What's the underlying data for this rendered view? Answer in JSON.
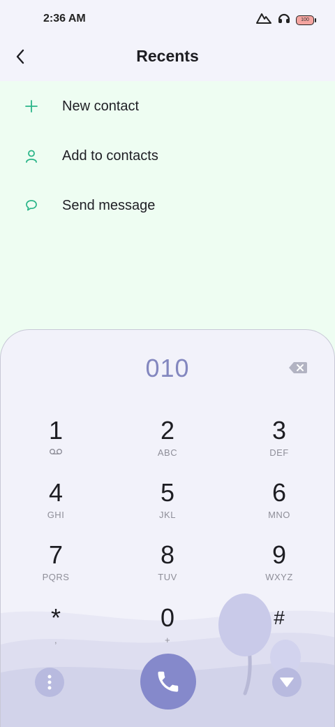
{
  "status_bar": {
    "time": "2:36 AM",
    "icons": [
      "signal-icon",
      "headset-icon",
      "battery-icon"
    ],
    "battery_level": "100"
  },
  "header": {
    "title": "Recents",
    "back_icon": "chevron-left-icon"
  },
  "actions": [
    {
      "label": "New contact",
      "icon": "plus-icon"
    },
    {
      "label": "Add to contacts",
      "icon": "person-icon"
    },
    {
      "label": "Send message",
      "icon": "message-bubble-icon"
    }
  ],
  "dialer": {
    "number": "010",
    "keys": [
      {
        "digit": "1",
        "sub": "voicemail-icon"
      },
      {
        "digit": "2",
        "sub": "ABC"
      },
      {
        "digit": "3",
        "sub": "DEF"
      },
      {
        "digit": "4",
        "sub": "GHI"
      },
      {
        "digit": "5",
        "sub": "JKL"
      },
      {
        "digit": "6",
        "sub": "MNO"
      },
      {
        "digit": "7",
        "sub": "PQRS"
      },
      {
        "digit": "8",
        "sub": "TUV"
      },
      {
        "digit": "9",
        "sub": "WXYZ"
      },
      {
        "digit": "*",
        "sub": ","
      },
      {
        "digit": "0",
        "sub": "+"
      },
      {
        "digit": "#",
        "sub": ""
      }
    ]
  },
  "colors": {
    "accent": "#8589cb",
    "action_icon": "#2bb589",
    "actions_bg": "#eefdf2",
    "number_text": "#8387bf"
  }
}
